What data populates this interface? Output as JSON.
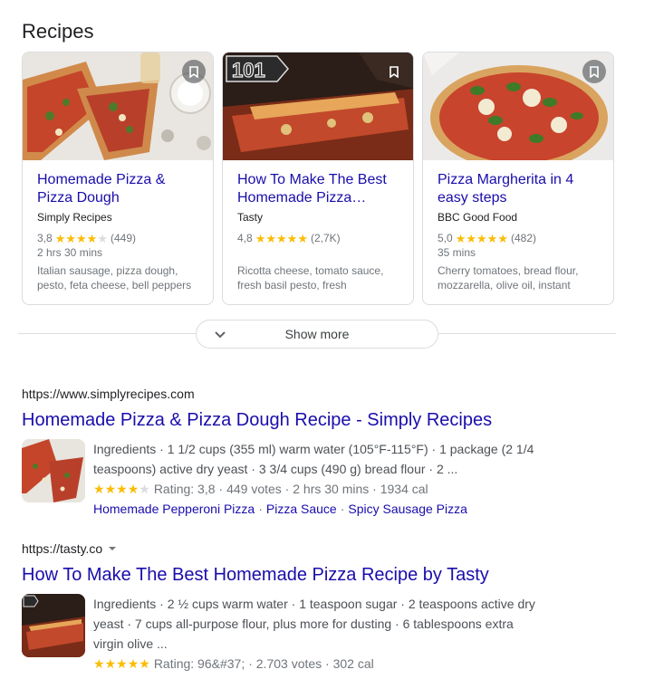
{
  "section_title": "Recipes",
  "cards": [
    {
      "title": "Homemade Pizza & Pizza Dough",
      "source": "Simply Recipes",
      "rating": "3,8",
      "stars": 4,
      "votes": "(449)",
      "time": "2 hrs 30 mins",
      "ingredients": "Italian sausage, pizza dough, pesto, feta cheese, bell peppers"
    },
    {
      "title": "How To Make The Best Homemade Pizza…",
      "source": "Tasty",
      "rating": "4,8",
      "stars": 5,
      "votes": "(2,7K)",
      "time": "",
      "ingredients": "Ricotta cheese, tomato sauce, fresh basil pesto, fresh",
      "badge": "101"
    },
    {
      "title": "Pizza Margherita in 4 easy steps",
      "source": "BBC Good Food",
      "rating": "5,0",
      "stars": 5,
      "votes": "(482)",
      "time": "35 mins",
      "ingredients": "Cherry tomatoes, bread flour, mozzarella, olive oil, instant"
    }
  ],
  "show_more_label": "Show more",
  "results": [
    {
      "url": "https://www.simplyrecipes.com",
      "title": "Homemade Pizza & Pizza Dough Recipe - Simply Recipes",
      "snippet": "Ingredients · 1 1/2 cups (355 ml) warm water (105°F-115°F) · 1 package (2 1/4 teaspoons) active dry yeast · 3 3/4 cups (490 g) bread flour · 2 ...",
      "stars": 4,
      "rating_text": "Rating: 3,8",
      "meta": "· 449 votes · 2 hrs 30 mins · 1934 cal",
      "links": [
        "Homemade Pepperoni Pizza",
        "Pizza Sauce",
        "Spicy Sausage Pizza"
      ]
    },
    {
      "url": "https://tasty.co",
      "title": "How To Make The Best Homemade Pizza Recipe by Tasty",
      "snippet": "Ingredients · 2 ½ cups warm water · 1 teaspoon sugar · 2 teaspoons active dry yeast · 7 cups all-purpose flour, plus more for dusting · 6 tablespoons extra virgin olive ...",
      "stars": 5,
      "rating_text": "Rating: 96&#37;",
      "meta": "· 2.703 votes · 302 cal"
    }
  ],
  "colors": {
    "link": "#1a0dab",
    "star": "#fbbc04",
    "muted": "#70757a",
    "border": "#dadce0"
  }
}
